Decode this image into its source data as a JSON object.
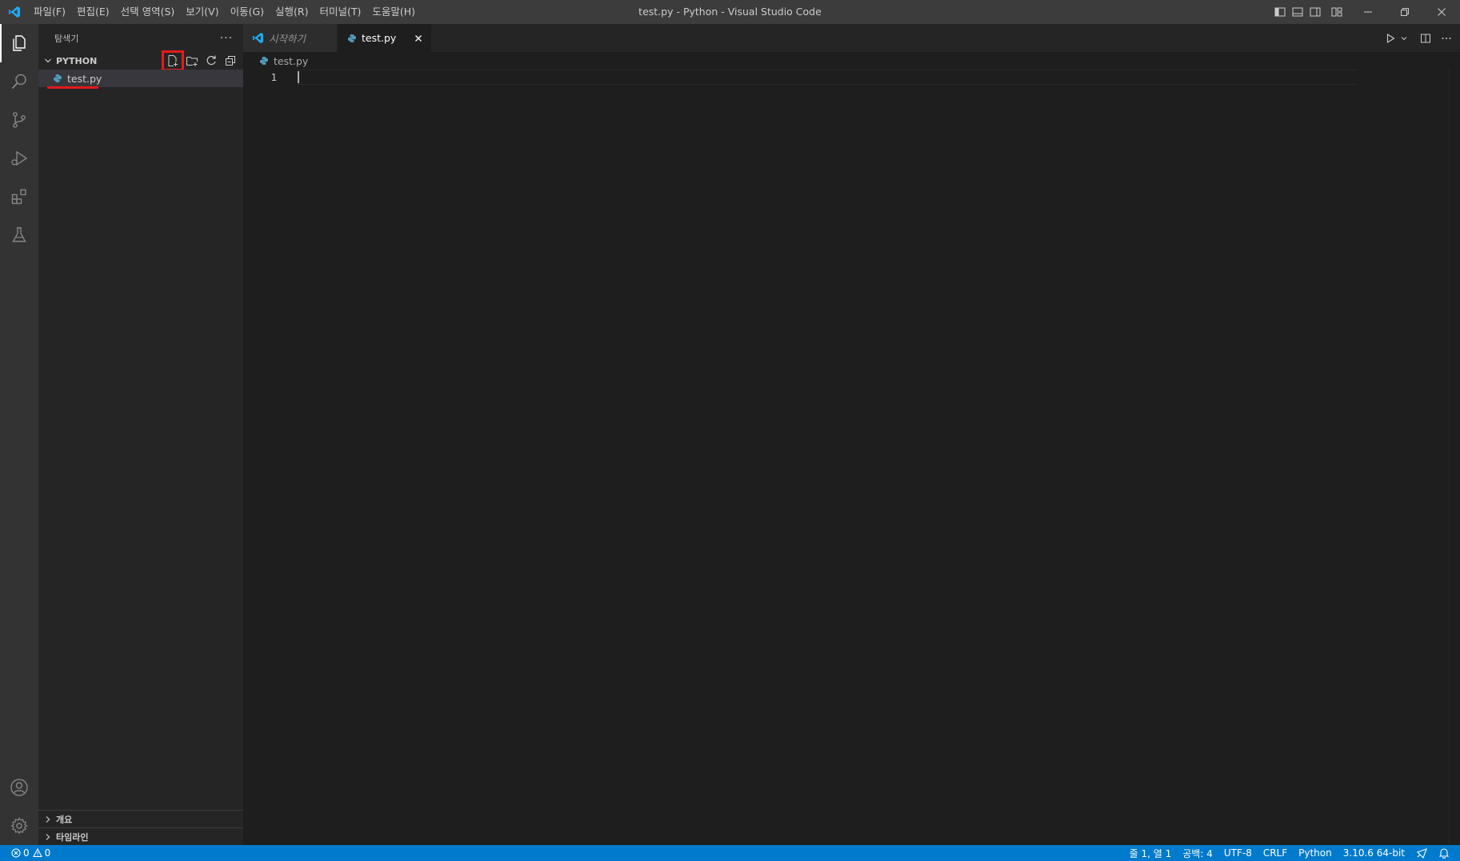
{
  "window": {
    "title": "test.py - Python - Visual Studio Code"
  },
  "menu": {
    "items": [
      "파일(F)",
      "편집(E)",
      "선택 영역(S)",
      "보기(V)",
      "이동(G)",
      "실행(R)",
      "터미널(T)",
      "도움말(H)"
    ]
  },
  "activity_bar": {
    "items": [
      "explorer-icon",
      "search-icon",
      "source-control-icon",
      "run-debug-icon",
      "extensions-icon",
      "testing-icon"
    ],
    "bottom_items": [
      "account-icon",
      "settings-gear-icon"
    ]
  },
  "sidebar": {
    "title": "탐색기",
    "more_label": "···",
    "folder": {
      "name": "PYTHON",
      "actions": [
        "new-file-icon",
        "new-folder-icon",
        "refresh-icon",
        "collapse-all-icon"
      ],
      "highlighted_action": "new-file-icon",
      "files": [
        {
          "name": "test.py",
          "selected": true
        }
      ]
    },
    "bottom_sections": [
      {
        "name": "개요"
      },
      {
        "name": "타임라인"
      }
    ]
  },
  "editor": {
    "tabs": [
      {
        "label": "시작하기",
        "active": false,
        "italic": true
      },
      {
        "label": "test.py",
        "active": true,
        "italic": false
      }
    ],
    "breadcrumb": "test.py",
    "lines": [
      {
        "number": "1",
        "text": ""
      }
    ]
  },
  "status_bar": {
    "errors": "0",
    "warnings": "0",
    "position": "줄 1, 열 1",
    "spaces": "공백: 4",
    "encoding": "UTF-8",
    "eol": "CRLF",
    "language": "Python",
    "interpreter": "3.10.6 64-bit"
  },
  "colors": {
    "accent": "#007acc",
    "highlight": "#e51a1a",
    "python_icon": "#519aba",
    "vscode_logo": "#23a9f2"
  }
}
